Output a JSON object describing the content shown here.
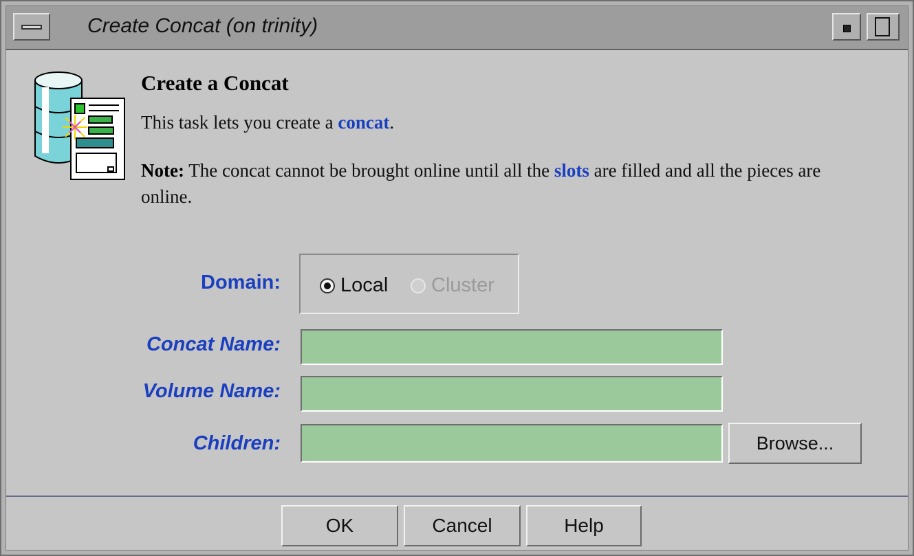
{
  "window": {
    "title": "Create Concat (on trinity)"
  },
  "header": {
    "heading": "Create a Concat",
    "desc_prefix": "This task lets you create a ",
    "desc_link": "concat",
    "desc_suffix": ".",
    "note_label": "Note:",
    "note_part1": " The concat cannot be brought online until all the ",
    "note_link": "slots",
    "note_part2": " are filled and all the pieces are online."
  },
  "form": {
    "domain_label": "Domain:",
    "domain_options": [
      {
        "label": "Local",
        "selected": true,
        "enabled": true
      },
      {
        "label": "Cluster",
        "selected": false,
        "enabled": false
      }
    ],
    "concat_name_label": "Concat Name:",
    "concat_name_value": "",
    "volume_name_label": "Volume Name:",
    "volume_name_value": "",
    "children_label": "Children:",
    "children_value": "",
    "browse_label": "Browse..."
  },
  "buttons": {
    "ok": "OK",
    "cancel": "Cancel",
    "help": "Help"
  },
  "colors": {
    "link": "#1a3fbf",
    "field_bg": "#9cc99b",
    "window_bg": "#c6c6c6"
  }
}
